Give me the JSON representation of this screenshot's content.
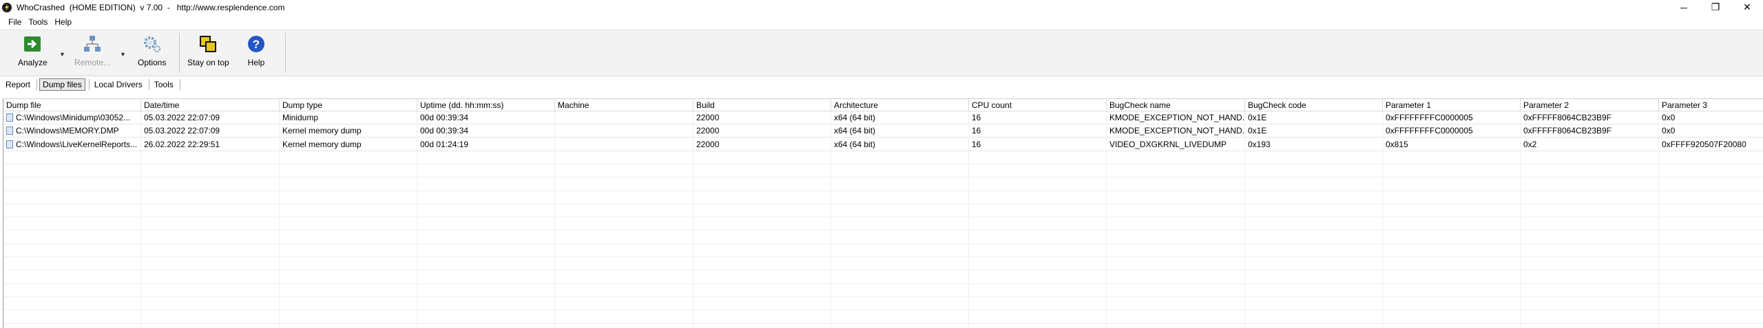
{
  "window": {
    "title": "WhoCrashed  (HOME EDITION)  v 7.00  -   http://www.resplendence.com",
    "minimize": "─",
    "maximize": "❐",
    "close": "✕"
  },
  "menu": {
    "file": "File",
    "tools": "Tools",
    "help": "Help"
  },
  "toolbar": {
    "analyze": "Analyze",
    "remote": "Remote...",
    "options": "Options",
    "stay_on_top": "Stay on top",
    "help": "Help"
  },
  "tabs": {
    "report": "Report",
    "dump_files": "Dump files",
    "local_drivers": "Local Drivers",
    "tools": "Tools"
  },
  "table": {
    "columns": [
      "Dump file",
      "Date/time",
      "Dump type",
      "Uptime (dd. hh:mm:ss)",
      "Machine",
      "Build",
      "Architecture",
      "CPU count",
      "BugCheck name",
      "BugCheck code",
      "Parameter 1",
      "Parameter 2",
      "Parameter 3"
    ],
    "rows": [
      [
        "C:\\Windows\\Minidump\\03052...",
        "05.03.2022 22:07:09",
        "Minidump",
        "00d 00:39:34",
        "",
        "22000",
        "x64 (64 bit)",
        "16",
        "KMODE_EXCEPTION_NOT_HAND...",
        "0x1E",
        "0xFFFFFFFFC0000005",
        "0xFFFFF8064CB23B9F",
        "0x0"
      ],
      [
        "C:\\Windows\\MEMORY.DMP",
        "05.03.2022 22:07:09",
        "Kernel memory dump",
        "00d 00:39:34",
        "",
        "22000",
        "x64 (64 bit)",
        "16",
        "KMODE_EXCEPTION_NOT_HAND...",
        "0x1E",
        "0xFFFFFFFFC0000005",
        "0xFFFFF8064CB23B9F",
        "0x0"
      ],
      [
        "C:\\Windows\\LiveKernelReports...",
        "26.02.2022 22:29:51",
        "Kernel memory dump",
        "00d 01:24:19",
        "",
        "22000",
        "x64 (64 bit)",
        "16",
        "VIDEO_DXGKRNL_LIVEDUMP",
        "0x193",
        "0x815",
        "0x2",
        "0xFFFF920507F20080"
      ]
    ]
  }
}
